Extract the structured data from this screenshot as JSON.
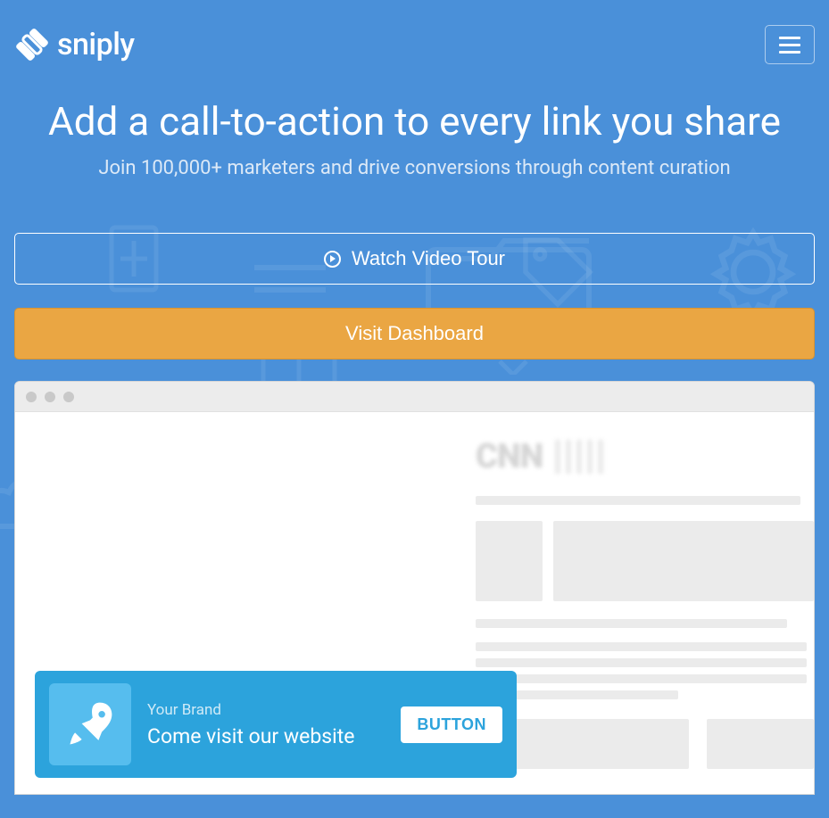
{
  "brand": "sniply",
  "hero": {
    "title": "Add a call-to-action to every link you share",
    "subtitle": "Join 100,000+ marketers and drive conversions through content curation"
  },
  "buttons": {
    "watch_video": "Watch Video Tour",
    "visit_dashboard": "Visit Dashboard"
  },
  "demo": {
    "publisher": "CNN"
  },
  "cta": {
    "brand_label": "Your Brand",
    "message": "Come visit our website",
    "button_label": "BUTTON"
  }
}
